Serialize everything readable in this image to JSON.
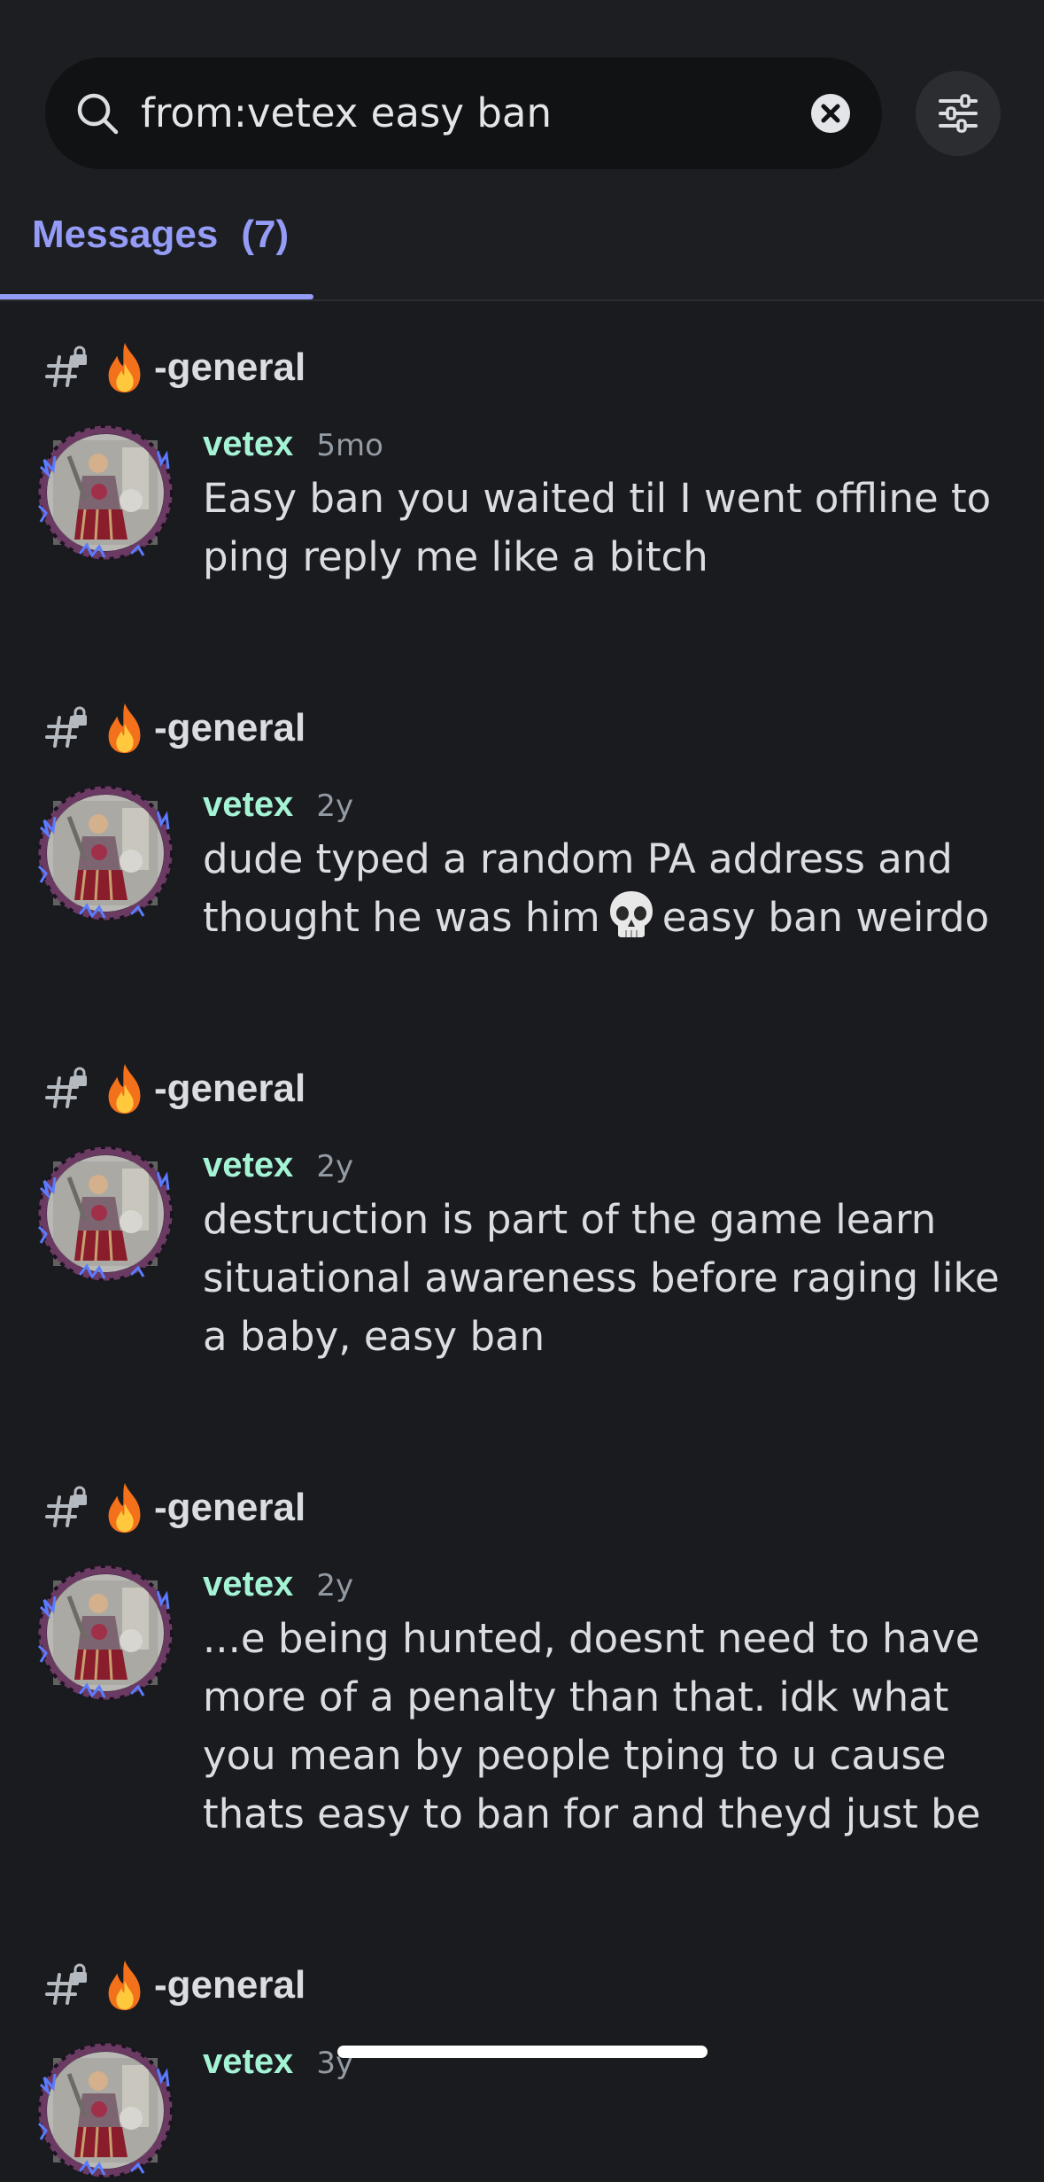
{
  "search": {
    "query": "from:vetex easy ban",
    "search_icon": "search-icon",
    "clear_icon": "clear-circle-icon",
    "filter_icon": "sliders-icon"
  },
  "tabs": [
    {
      "label": "Messages",
      "count": "(7)",
      "active": true
    }
  ],
  "colors": {
    "accent": "#949cf7",
    "author": "#a5f3d5",
    "background": "#1a1b1f",
    "search_background": "#111214",
    "timestamp": "#949ba4"
  },
  "results": [
    {
      "channel": "-general",
      "channel_icon": "hashtag-locked-icon",
      "channel_emoji": "fire-emoji",
      "author": "vetex",
      "time": "5mo",
      "lines": [
        "Easy ban you waited til I went offline to",
        "ping reply me like a bitch"
      ]
    },
    {
      "channel": "-general",
      "channel_icon": "hashtag-locked-icon",
      "channel_emoji": "fire-emoji",
      "author": "vetex",
      "time": "2y",
      "lines": [
        "dude typed a random PA address and",
        "thought he was him",
        "easy ban weirdo"
      ]
    },
    {
      "channel": "-general",
      "channel_icon": "hashtag-locked-icon",
      "channel_emoji": "fire-emoji",
      "author": "vetex",
      "time": "2y",
      "lines": [
        "destruction is part of the game learn",
        "situational awareness before raging like",
        "a baby, easy ban"
      ]
    },
    {
      "channel": "-general",
      "channel_icon": "hashtag-locked-icon",
      "channel_emoji": "fire-emoji",
      "author": "vetex",
      "time": "2y",
      "lines": [
        "...e being hunted, doesnt need to have",
        "more of a penalty than that. idk what",
        "you mean by people tping to u cause",
        "thats easy to ban for and theyd just be"
      ]
    },
    {
      "channel": "-general",
      "channel_icon": "hashtag-locked-icon",
      "channel_emoji": "fire-emoji",
      "author": "vetex",
      "time": "3y",
      "lines": []
    }
  ]
}
